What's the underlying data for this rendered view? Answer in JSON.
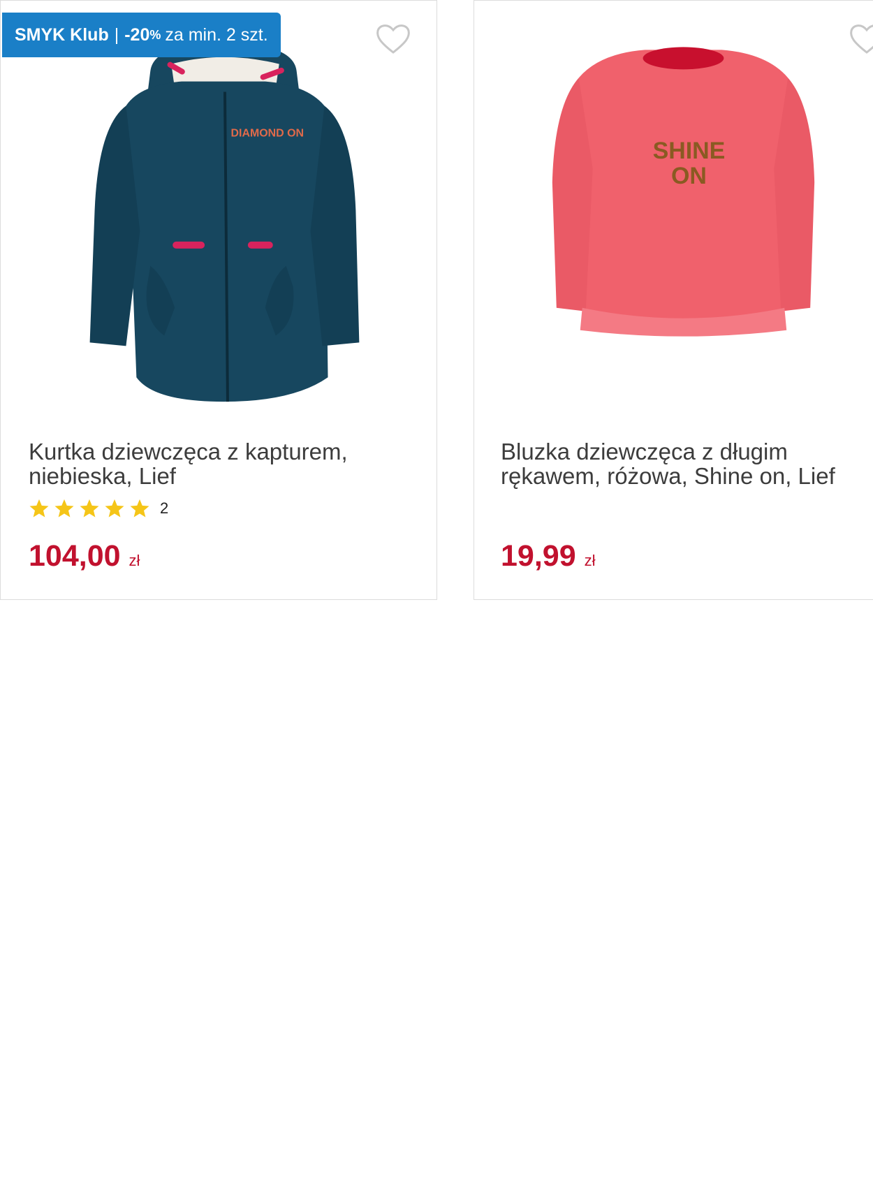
{
  "products": [
    {
      "badge": {
        "brand": "SMYK Klub",
        "separator": "|",
        "discount": "-20",
        "percent": "%",
        "condition": "za min. 2 szt."
      },
      "title": "Kurtka dziewczęca z kapturem, niebieska, Lief",
      "rating": {
        "stars": 5,
        "count": "2"
      },
      "price": "104,00",
      "currency": "zł",
      "image": {
        "type": "jacket",
        "body_color": "#17475f",
        "accent_color": "#d8235d",
        "print_text": "DIAMOND ON"
      }
    },
    {
      "title": "Bluzka dziewczęca z długim rękawem, różowa, Shine on, Lief",
      "price": "19,99",
      "currency": "zł",
      "image": {
        "type": "tshirt",
        "body_color": "#f0616c",
        "neck_color": "#c8102e",
        "print_text_line1": "SHINE",
        "print_text_line2": "ON"
      }
    }
  ],
  "colors": {
    "badge_bg": "#1a7fc7",
    "price": "#c1112e",
    "star": "#f5c518",
    "heart": "#c7c7c7"
  }
}
